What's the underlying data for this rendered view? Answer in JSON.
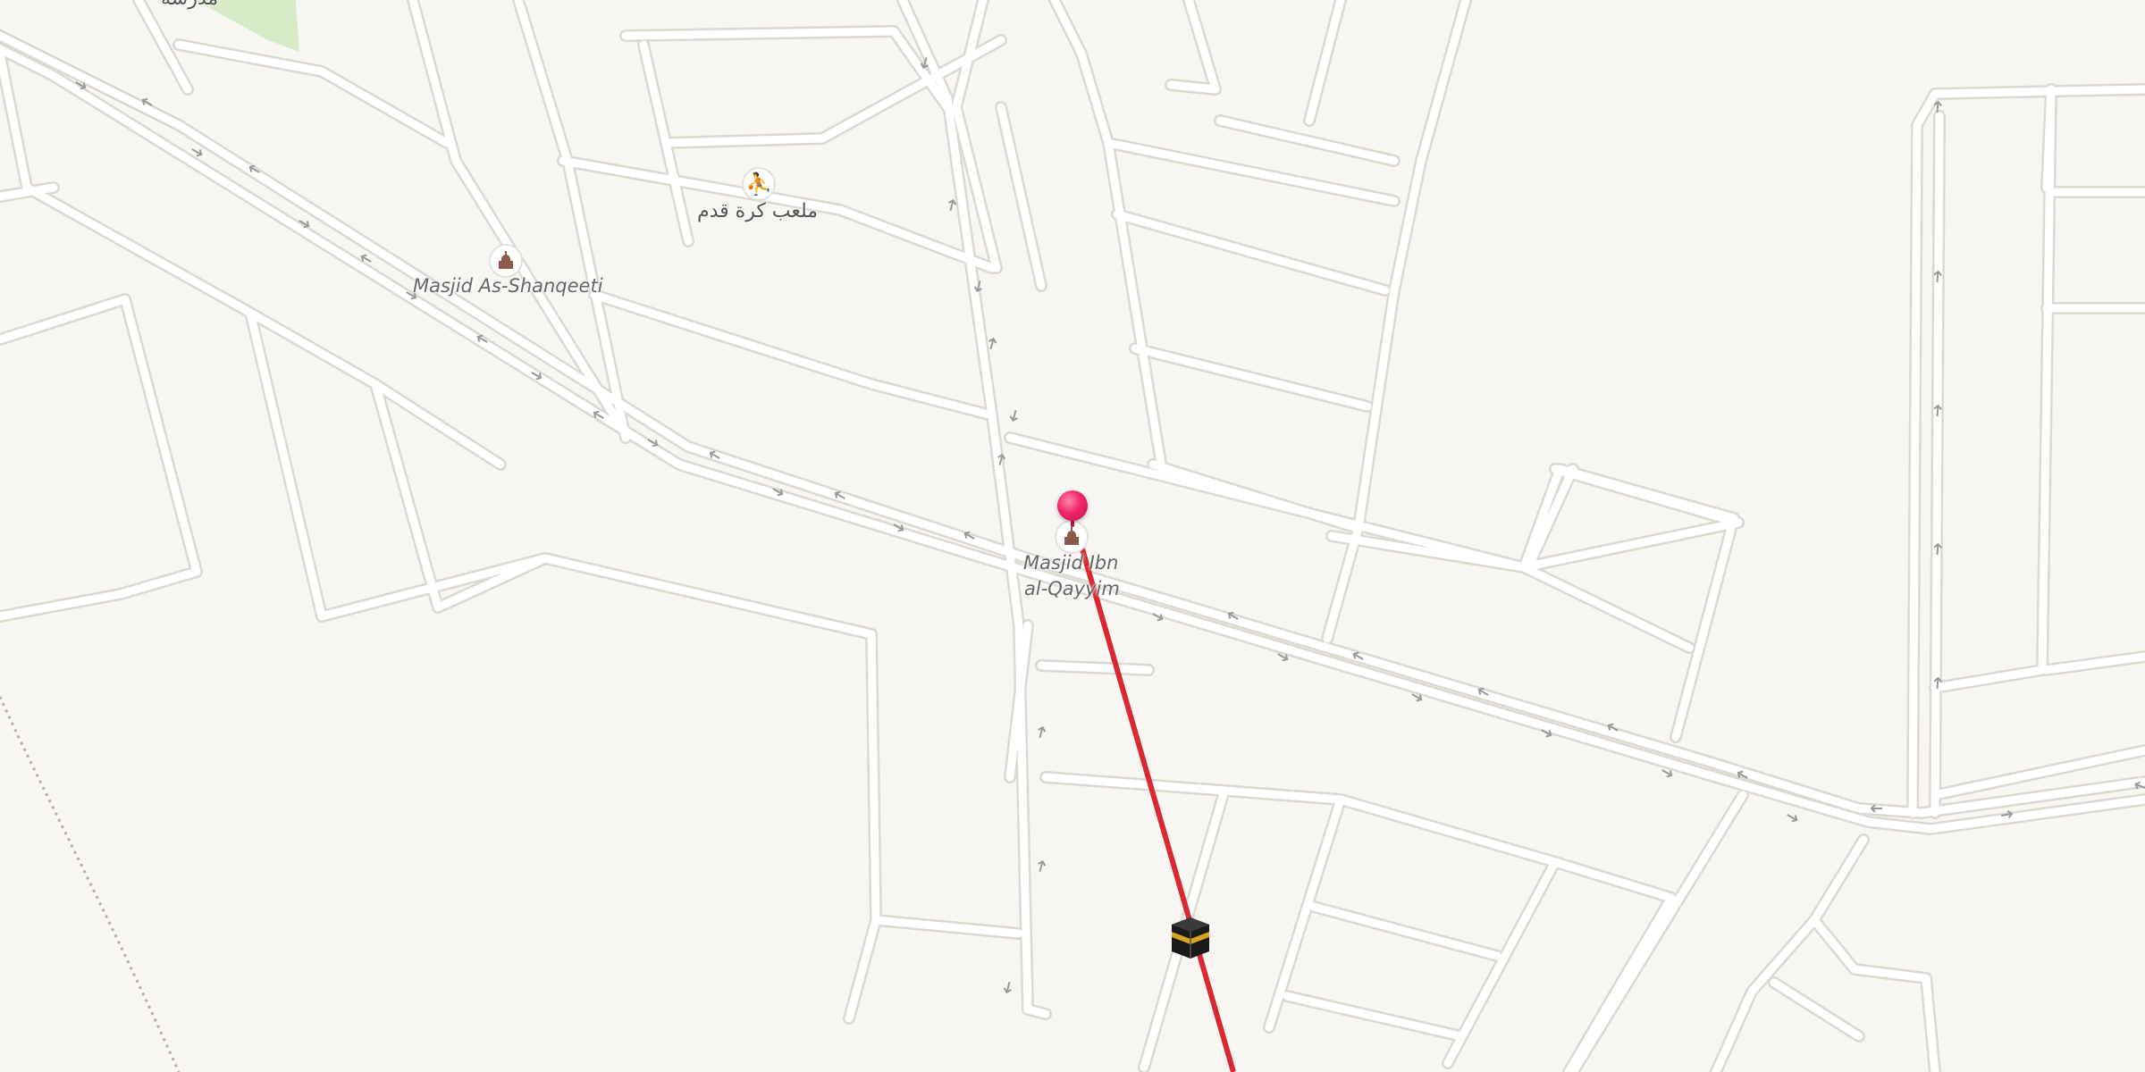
{
  "map": {
    "labels": {
      "shanqeeti": "Masjid As-Shanqeeti",
      "ibn_qayyim_line1": "Masjid Ibn",
      "ibn_qayyim_line2": "al-Qayyim",
      "football": "ملعب كرة قدم",
      "top_partial": "مدرسة"
    },
    "icons": {
      "mosque": "mosque-icon",
      "football": "football-pitch-icon",
      "pin": "location-pin-icon",
      "kaaba": "kaaba-icon"
    },
    "colors": {
      "background": "#f8f6f2",
      "road_fill": "#ffffff",
      "road_casing": "#dcd8d2",
      "qibla_line": "#d9282f",
      "pin": "#f0246a",
      "park": "#d8ebc8",
      "arrow": "#9a9a9a"
    }
  }
}
